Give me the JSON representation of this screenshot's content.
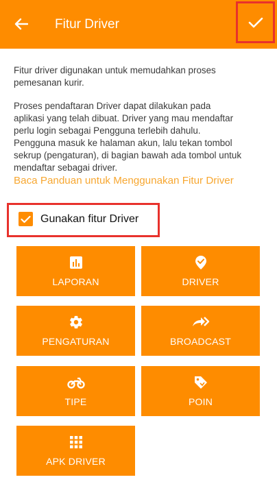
{
  "appbar": {
    "title": "Fitur Driver"
  },
  "description": {
    "paragraph1": [
      "Fitur driver digunakan untuk memudahkan proses",
      "pemesanan kurir."
    ],
    "paragraph2": [
      "Proses pendaftaran Driver dapat dilakukan pada",
      "aplikasi yang telah dibuat. Driver yang mau mendaftar",
      "perlu login sebagai Pengguna terlebih dahulu.",
      "Pengguna masuk ke halaman akun, lalu tekan tombol",
      "sekrup (pengaturan), di bagian bawah ada tombol untuk",
      "mendaftar sebagai driver."
    ],
    "guide_link": "Baca Panduan untuk Menggunakan Fitur Driver"
  },
  "checkbox": {
    "label": "Gunakan fitur Driver",
    "checked": true
  },
  "tiles": [
    {
      "label": "LAPORAN",
      "icon": "report-chart-icon"
    },
    {
      "label": "DRIVER",
      "icon": "verified-badge-icon"
    },
    {
      "label": "PENGATURAN",
      "icon": "gear-icon"
    },
    {
      "label": "BROADCAST",
      "icon": "share-arrow-icon"
    },
    {
      "label": "TIPE",
      "icon": "motorcycle-icon"
    },
    {
      "label": "POIN",
      "icon": "tag-icon"
    },
    {
      "label": "APK DRIVER",
      "icon": "apps-grid-icon"
    }
  ],
  "colors": {
    "primary": "#fe8c00",
    "link": "#f7a731",
    "highlight": "#e8312c"
  }
}
